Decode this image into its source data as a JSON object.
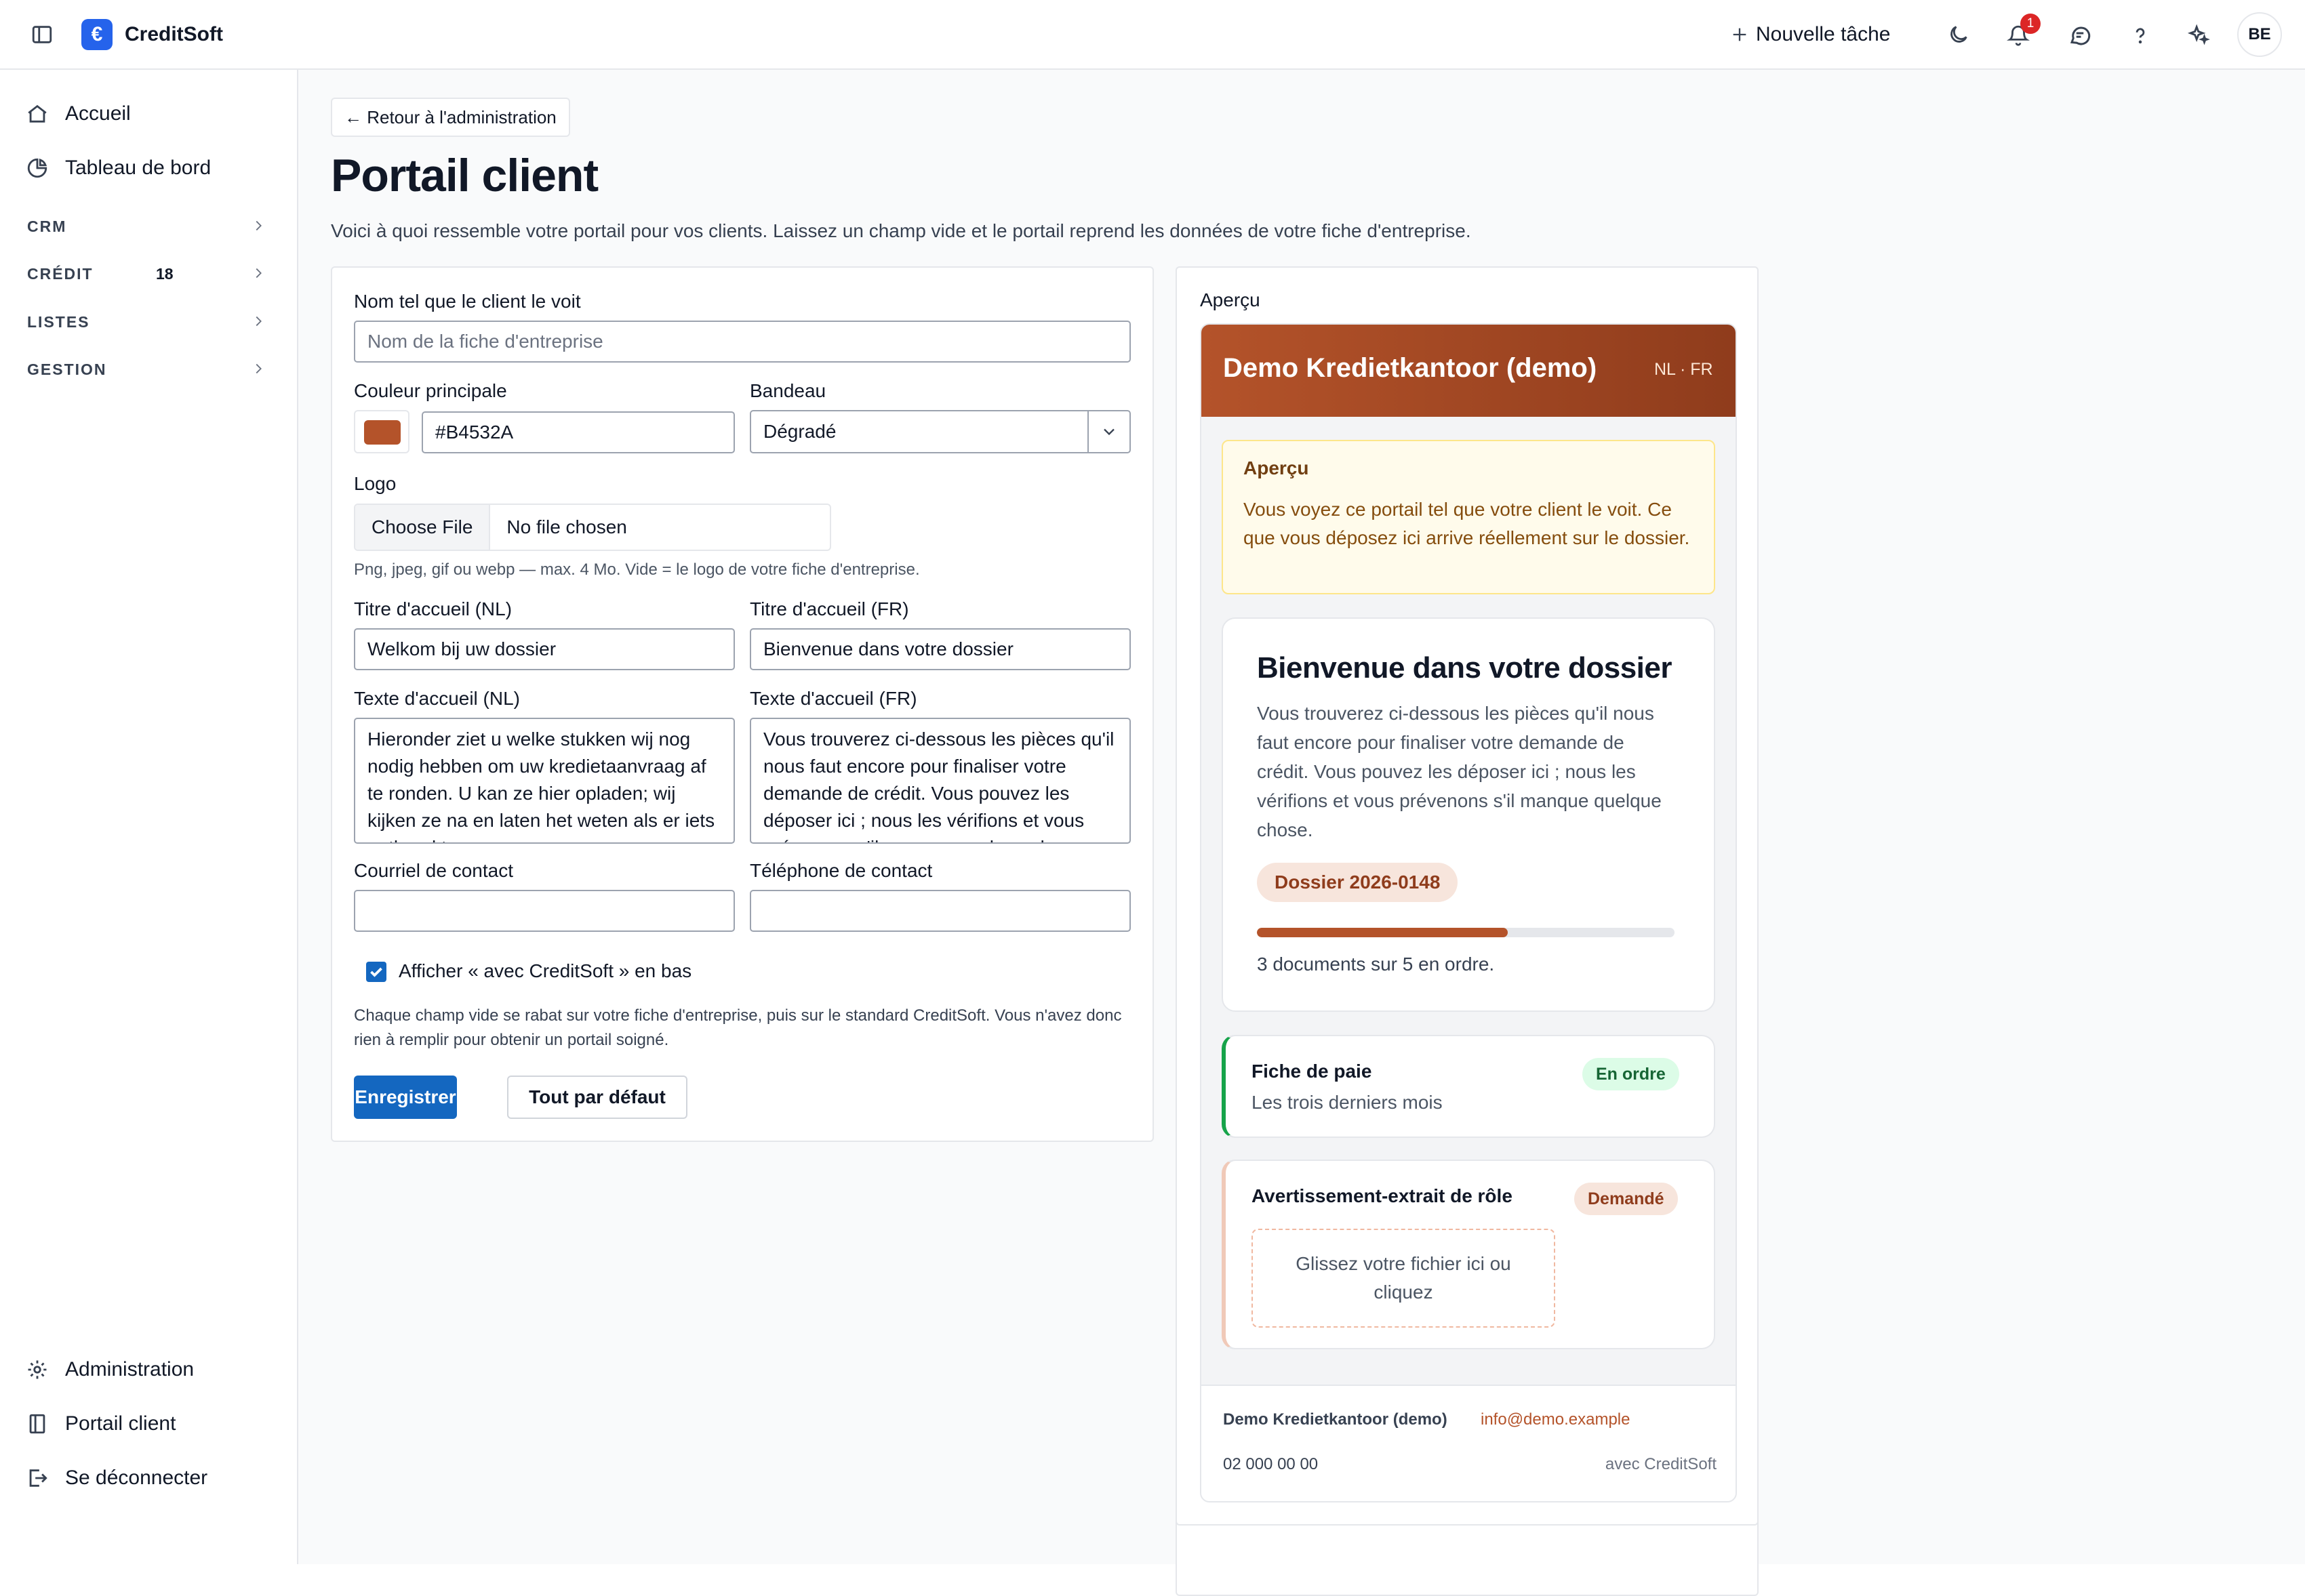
{
  "app": {
    "name": "CreditSoft",
    "logo_glyph": "€"
  },
  "topbar": {
    "new_task": "Nouvelle tâche",
    "notif_count": "1",
    "avatar": "BE"
  },
  "sidebar": {
    "home": "Accueil",
    "dashboard": "Tableau de bord",
    "sections": [
      {
        "label": "CRM",
        "count": ""
      },
      {
        "label": "CRÉDIT",
        "count": "18"
      },
      {
        "label": "LISTES",
        "count": ""
      },
      {
        "label": "GESTION",
        "count": ""
      }
    ],
    "admin": "Administration",
    "portal": "Portail client",
    "logout": "Se déconnecter"
  },
  "page": {
    "back": "← Retour à l'administration",
    "title": "Portail client",
    "subtitle": "Voici à quoi ressemble votre portail pour vos clients. Laissez un champ vide et le portail reprend les données de votre fiche d'entreprise."
  },
  "form": {
    "name_label": "Nom tel que le client le voit",
    "name_placeholder": "Nom de la fiche d'entreprise",
    "color_label": "Couleur principale",
    "color_value": "#B4532A",
    "banner_label": "Bandeau",
    "banner_value": "Dégradé",
    "logo_label": "Logo",
    "file_button": "Choose File",
    "file_status": "No file chosen",
    "logo_help": "Png, jpeg, gif ou webp — max. 4 Mo. Vide = le logo de votre fiche d'entreprise.",
    "title_nl_label": "Titre d'accueil (NL)",
    "title_nl_value": "Welkom bij uw dossier",
    "title_fr_label": "Titre d'accueil (FR)",
    "title_fr_value": "Bienvenue dans votre dossier",
    "text_nl_label": "Texte d'accueil (NL)",
    "text_nl_value": "Hieronder ziet u welke stukken wij nog nodig hebben om uw kredietaanvraag af te ronden. U kan ze hier opladen; wij kijken ze na en laten het weten als er iets ontbreekt.",
    "text_fr_label": "Texte d'accueil (FR)",
    "text_fr_value": "Vous trouverez ci-dessous les pièces qu'il nous faut encore pour finaliser votre demande de crédit. Vous pouvez les déposer ici ; nous les vérifions et vous prévenons s'il manque quelque chose.",
    "email_label": "Courriel de contact",
    "email_value": "",
    "phone_label": "Téléphone de contact",
    "phone_value": "",
    "show_footer_label": "Afficher « avec CreditSoft » en bas",
    "help": "Chaque champ vide se rabat sur votre fiche d'entreprise, puis sur le standard CreditSoft. Vous n'avez donc rien à remplir pour obtenir un portail soigné.",
    "save": "Enregistrer",
    "reset": "Tout par défaut"
  },
  "preview": {
    "label": "Aperçu",
    "company": "Demo Kredietkantoor (demo)",
    "langs": "NL · FR",
    "notice_title": "Aperçu",
    "notice_text": "Vous voyez ce portail tel que votre client le voit. Ce que vous déposez ici arrive réellement sur le dossier.",
    "welcome_title": "Bienvenue dans votre dossier",
    "welcome_text": "Vous trouverez ci-dessous les pièces qu'il nous faut encore pour finaliser votre demande de crédit. Vous pouvez les déposer ici ; nous les vérifions et vous prévenons s'il manque quelque chose.",
    "dossier": "Dossier 2026-0148",
    "progress": 0.6,
    "progress_text": "3 documents sur 5 en ordre.",
    "doc1_title": "Fiche de paie",
    "doc1_sub": "Les trois derniers mois",
    "doc1_status": "En ordre",
    "doc2_title": "Avertissement-extrait de rôle",
    "doc2_status": "Demandé",
    "drop": "Glissez votre fichier ici ou cliquez",
    "footer_company": "Demo Kredietkantoor (demo)",
    "footer_email": "info@demo.example",
    "footer_phone": "02 000 00 00",
    "footer_brand": "avec CreditSoft"
  },
  "colors": {
    "accent": "#B4532A",
    "primary": "#1467c0",
    "success": "#16a34a"
  }
}
